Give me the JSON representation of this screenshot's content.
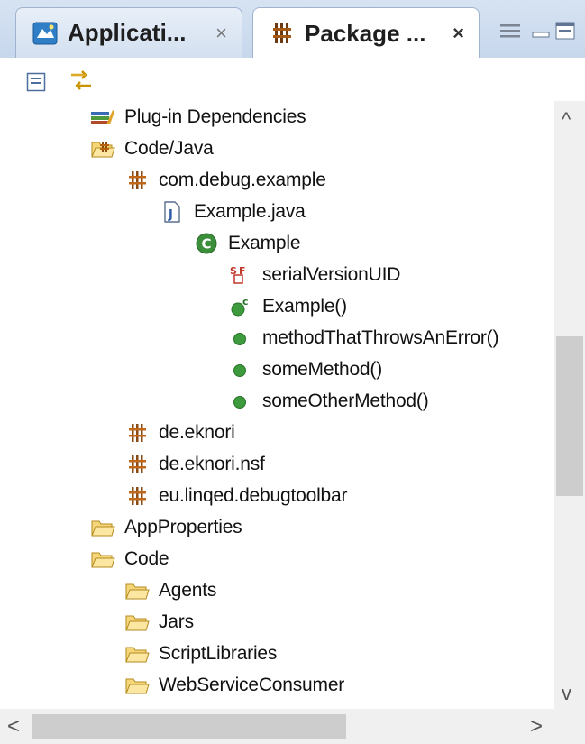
{
  "tabs": [
    {
      "label": "Applicati...",
      "close": "×",
      "icon": "application-navigator-icon",
      "active": false
    },
    {
      "label": "Package ...",
      "close": "×",
      "icon": "package-explorer-icon",
      "active": true
    }
  ],
  "view_controls": {
    "menu_icon": "view-menu-icon",
    "minimize_icon": "minimize-icon",
    "maximize_icon": "maximize-icon"
  },
  "toolbar": {
    "collapse_icon": "collapse-all-icon",
    "link_icon": "link-with-editor-icon"
  },
  "tree": {
    "items": [
      {
        "label": "Plug-in Dependencies",
        "icon": "library-icon"
      },
      {
        "label": "Code/Java",
        "icon": "package-folder-icon"
      },
      {
        "label": "com.debug.example",
        "icon": "package-icon"
      },
      {
        "label": "Example.java",
        "icon": "java-file-icon"
      },
      {
        "label": "Example",
        "icon": "class-icon"
      },
      {
        "label": "serialVersionUID",
        "icon": "static-final-field-icon"
      },
      {
        "label": "Example()",
        "icon": "constructor-icon"
      },
      {
        "label": "methodThatThrowsAnError()",
        "icon": "public-method-icon"
      },
      {
        "label": "someMethod()",
        "icon": "public-method-icon"
      },
      {
        "label": "someOtherMethod()",
        "icon": "public-method-icon"
      },
      {
        "label": "de.eknori",
        "icon": "package-icon"
      },
      {
        "label": "de.eknori.nsf",
        "icon": "package-icon"
      },
      {
        "label": "eu.linqed.debugtoolbar",
        "icon": "package-icon"
      },
      {
        "label": "AppProperties",
        "icon": "folder-icon"
      },
      {
        "label": "Code",
        "icon": "folder-icon"
      },
      {
        "label": "Agents",
        "icon": "folder-icon"
      },
      {
        "label": "Jars",
        "icon": "folder-icon"
      },
      {
        "label": "ScriptLibraries",
        "icon": "folder-icon"
      },
      {
        "label": "WebServiceConsumer",
        "icon": "folder-icon"
      }
    ]
  },
  "scrollbars": {
    "up": "^",
    "down": "v",
    "left": "<",
    "right": ">"
  },
  "colors": {
    "tab_strip": "#c7d7ec",
    "package_orange": "#b8600a",
    "method_green": "#3d9a3d",
    "folder_yellow": "#f5d77a",
    "scroll_thumb": "#cdcdcd"
  }
}
